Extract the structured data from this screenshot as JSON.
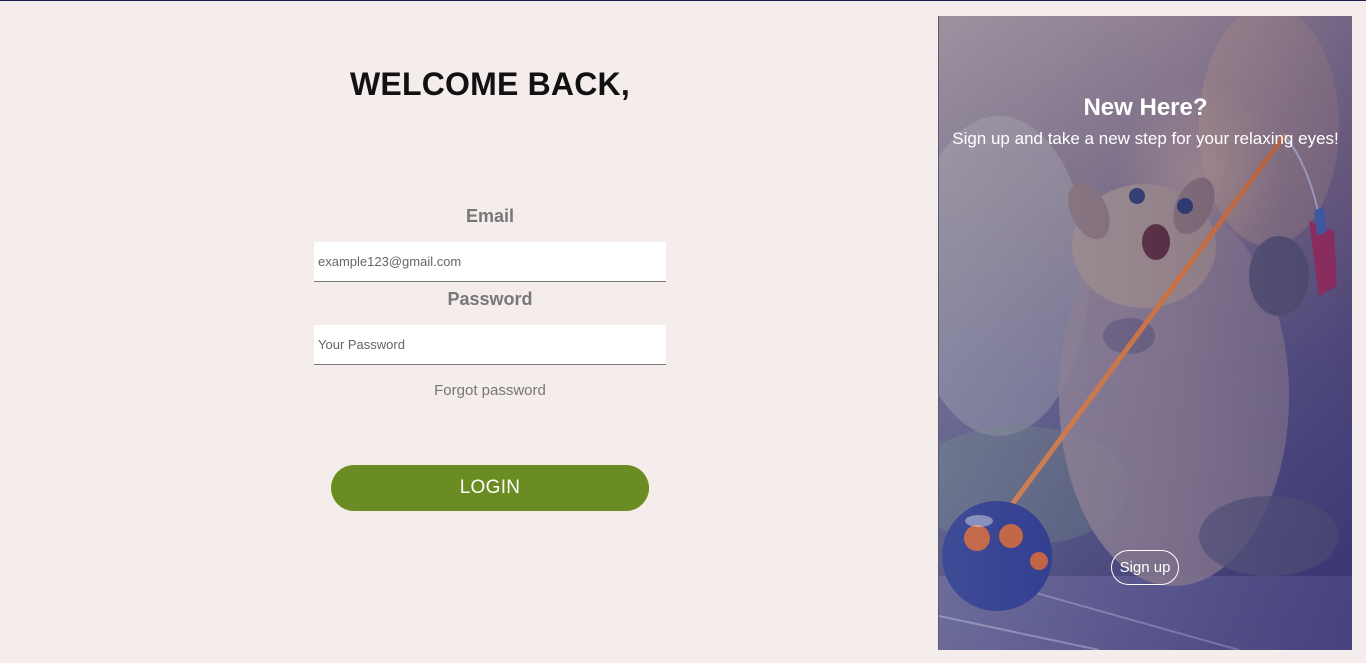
{
  "login": {
    "title": "WELCOME BACK,",
    "email_label": "Email",
    "email_placeholder": "example123@gmail.com",
    "password_label": "Password",
    "password_placeholder": "Your Password",
    "forgot_label": "Forgot password",
    "login_button": "LOGIN"
  },
  "signup": {
    "title": "New Here?",
    "text": "Sign up and take a new step for your relaxing eyes!",
    "button": "Sign up"
  },
  "colors": {
    "background": "#f5ecec",
    "login_button": "#6b8c22"
  },
  "icons": {
    "background_image": "kitten-photo"
  }
}
